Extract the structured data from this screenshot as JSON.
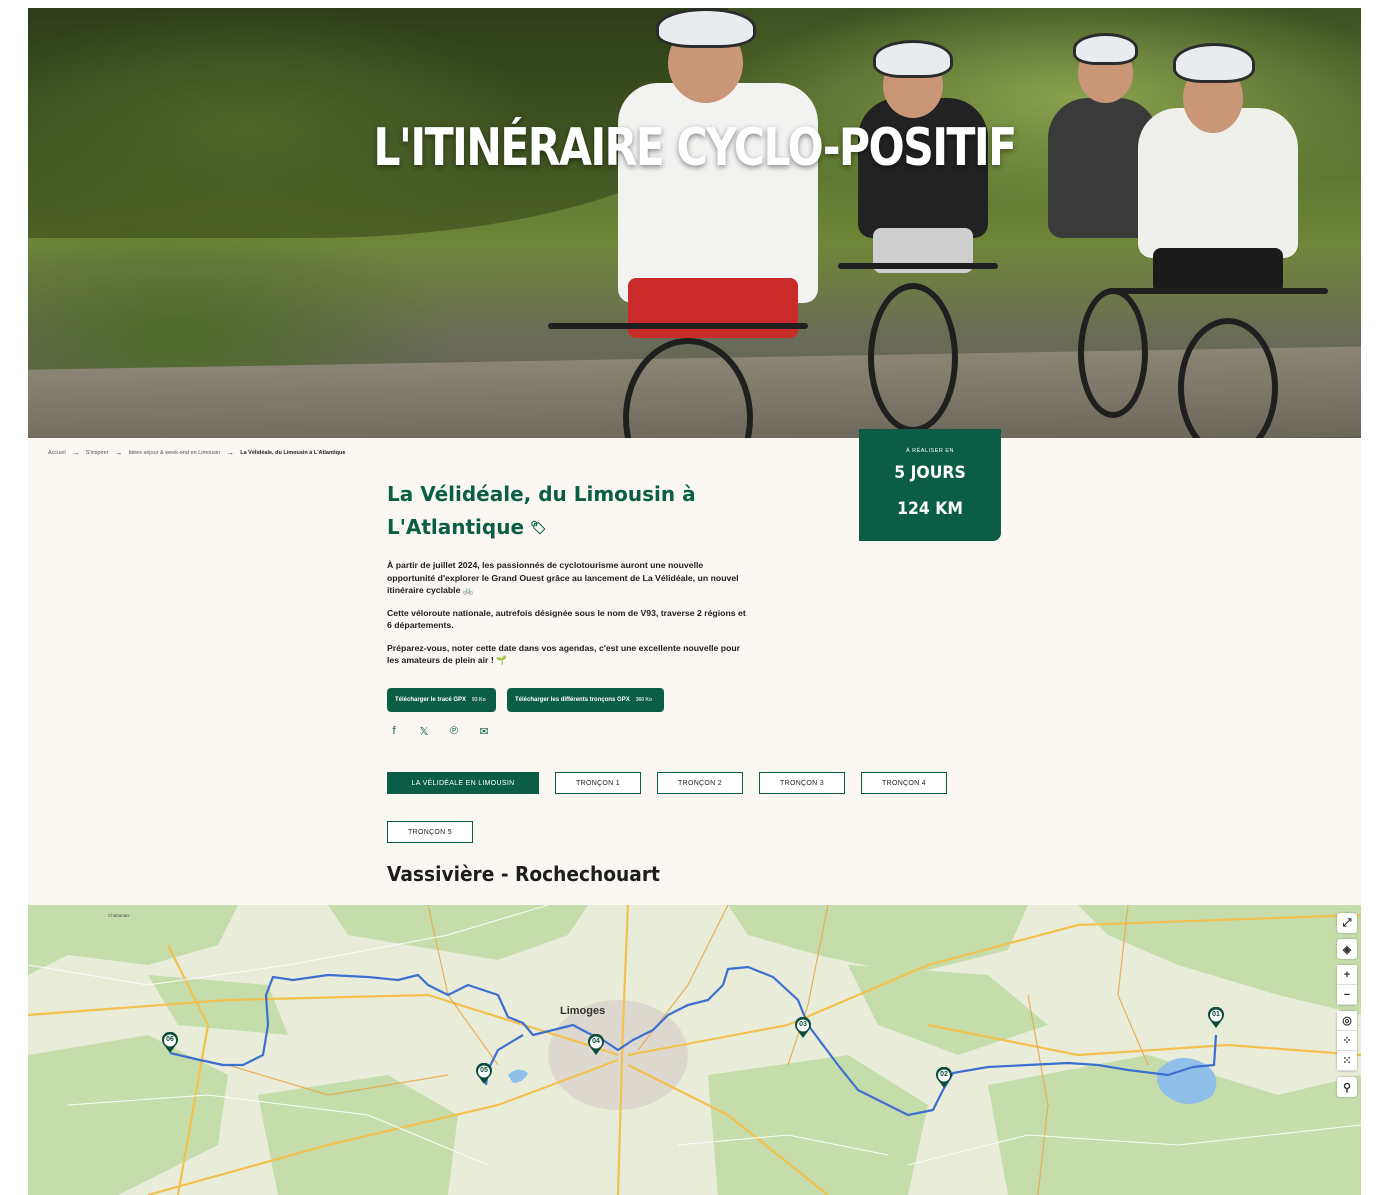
{
  "hero": {
    "title": "L'ITINÉRAIRE CYCLO-POSITIF"
  },
  "breadcrumb": [
    "Accueil",
    "S'inspirer",
    "Idées séjour & week-end en Limousin",
    "La Vélidéale, du Limousin à L'Atlantique"
  ],
  "info_box": {
    "label": "À RÉALISER EN",
    "duration": "5 JOURS",
    "distance": "124 KM"
  },
  "article": {
    "title": "La Vélidéale, du Limousin à L'Atlantique",
    "title_icon": "tag-icon",
    "paragraphs": [
      "À partir de juillet 2024, les passionnés de cyclotourisme auront une nouvelle opportunité d'explorer le Grand Ouest grâce au lancement de La Vélidéale, un nouvel itinéraire cyclable 🚲",
      "Cette véloroute nationale, autrefois désignée sous le nom de V93, traverse 2 régions et 6 départements.",
      "Préparez-vous, noter cette date dans vos agendas, c'est une excellente nouvelle pour les amateurs de plein air ! 🌱"
    ]
  },
  "downloads": {
    "gpx_trace": "Télécharger le tracé GPX",
    "gpx_trace_size": "93 Ko",
    "gpx_sections": "Télécharger les différents tronçons GPX",
    "gpx_sections_size": "360 Ko"
  },
  "share": {
    "icons": [
      "facebook-icon",
      "x-icon",
      "pinterest-icon",
      "email-icon"
    ],
    "glyphs": [
      "f",
      "𝕏",
      "℗",
      "✉"
    ]
  },
  "tabs": [
    {
      "label": "LA VÉLIDÉALE EN LIMOUSIN",
      "active": true
    },
    {
      "label": "TRONÇON 1",
      "active": false
    },
    {
      "label": "TRONÇON 2",
      "active": false
    },
    {
      "label": "TRONÇON 3",
      "active": false
    },
    {
      "label": "TRONÇON 4",
      "active": false
    },
    {
      "label": "TRONÇON 5",
      "active": false
    }
  ],
  "section": {
    "title": "Vassivière - Rochechouart"
  },
  "map": {
    "city": "Limoges",
    "markers": [
      "01",
      "02",
      "03",
      "04",
      "05",
      "06"
    ],
    "controls": [
      "fullscreen-icon",
      "layers-icon",
      "zoom-in-icon",
      "zoom-out-icon",
      "locate-icon",
      "points-icon",
      "points-alt-icon",
      "search-icon"
    ],
    "route_color": "#3d6fd1",
    "marker_color": "#0b4d3a"
  },
  "colors": {
    "brand": "#0b5e45",
    "background": "#fbf8f4"
  }
}
